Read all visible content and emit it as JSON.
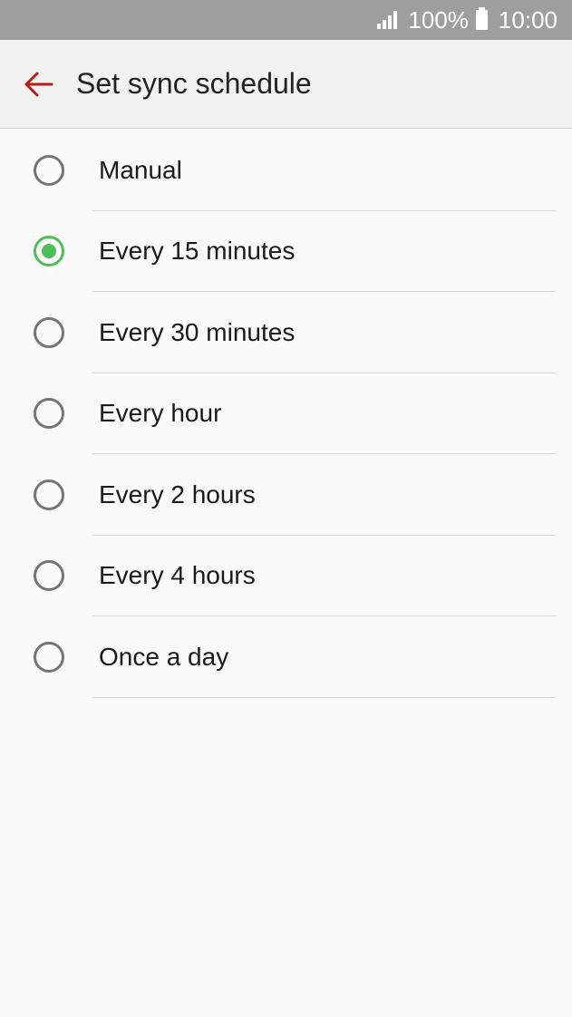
{
  "status_bar": {
    "battery_percent": "100%",
    "time": "10:00",
    "signal_icon": "signal-icon",
    "battery_icon": "battery-icon"
  },
  "app_bar": {
    "back_icon": "arrow-back-icon",
    "title": "Set sync schedule"
  },
  "colors": {
    "accent": "#4fbe5a",
    "back_arrow": "#b71c1c",
    "status_bar_bg": "#9e9e9e"
  },
  "options": [
    {
      "label": "Manual",
      "selected": false
    },
    {
      "label": "Every 15 minutes",
      "selected": true
    },
    {
      "label": "Every 30 minutes",
      "selected": false
    },
    {
      "label": "Every hour",
      "selected": false
    },
    {
      "label": "Every 2 hours",
      "selected": false
    },
    {
      "label": "Every 4 hours",
      "selected": false
    },
    {
      "label": "Once a day",
      "selected": false
    }
  ]
}
